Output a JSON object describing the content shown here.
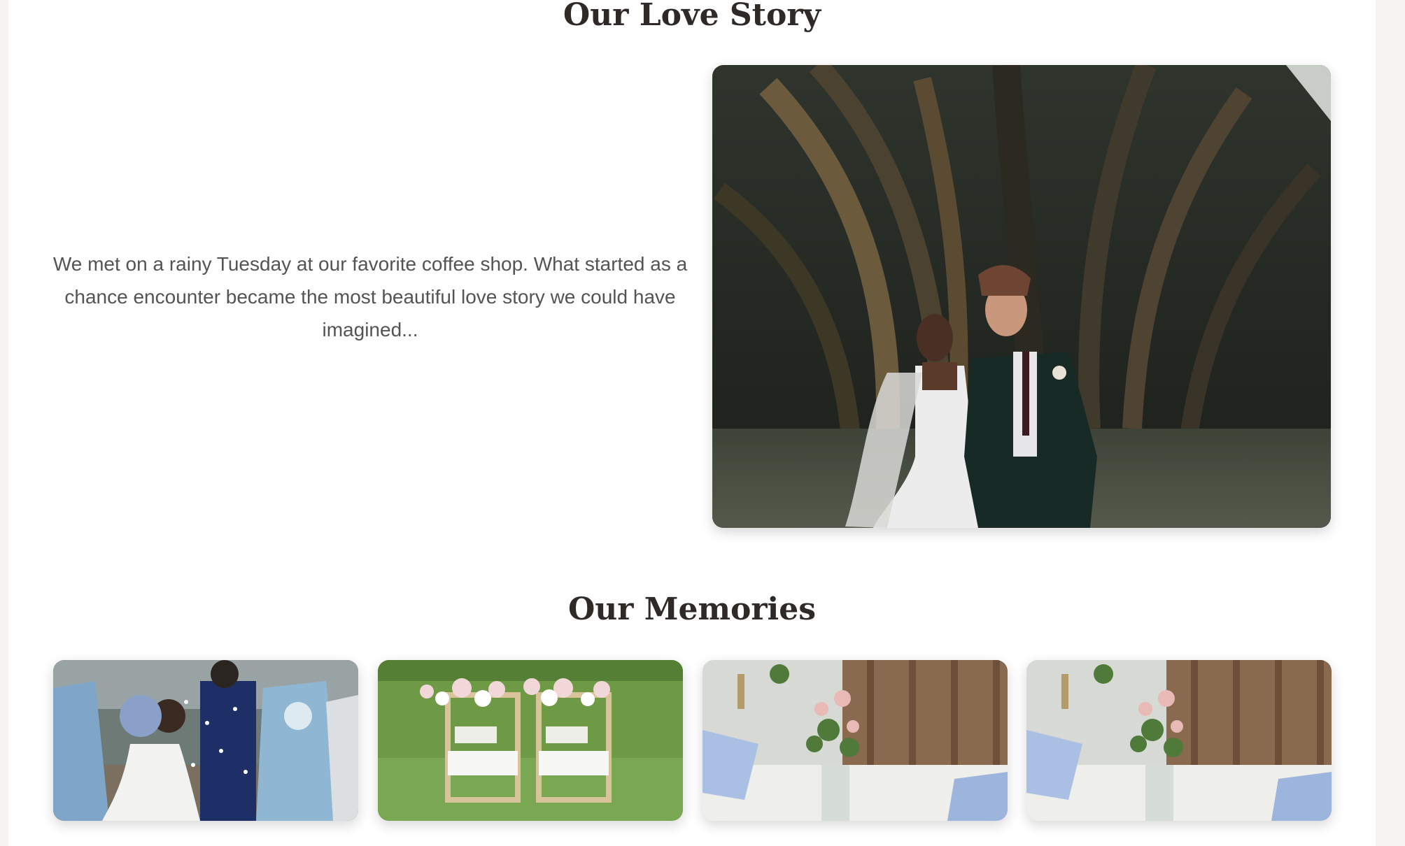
{
  "story": {
    "title": "Our Love Story",
    "text": "We met on a rainy Tuesday at our favorite coffee shop. What started as a chance encounter became the most beautiful love story we could have imagined..."
  },
  "memories": {
    "title": "Our Memories"
  },
  "colors": {
    "heading": "#2f2a27",
    "body_text": "#545454",
    "page_background": "#ffffff",
    "outer_background": "#f4f3ef"
  },
  "images": {
    "main": "couple-walking-under-palm-tree",
    "gallery": [
      "petal-toss-with-bridesmaids",
      "decorated-chairs-on-lawn",
      "floral-table-setting",
      "floral-table-setting"
    ]
  }
}
